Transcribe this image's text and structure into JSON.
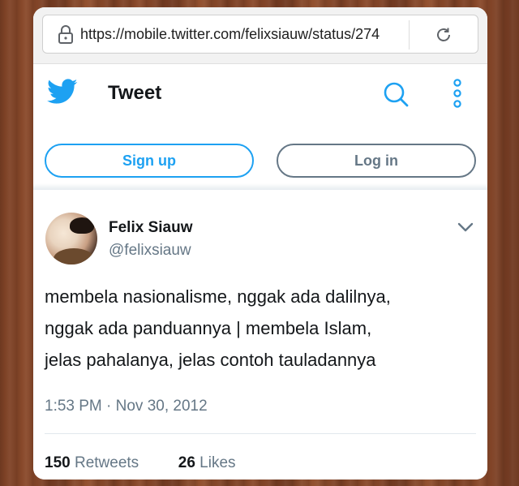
{
  "browser": {
    "url": "https://mobile.twitter.com/felixsiauw/status/274",
    "icons": {
      "lock": "lock-icon",
      "reload": "reload-icon"
    }
  },
  "header": {
    "title": "Tweet",
    "icons": {
      "logo": "twitter-bird-icon",
      "search": "search-icon",
      "more": "more-vertical-icon"
    },
    "signup_label": "Sign up",
    "login_label": "Log in"
  },
  "tweet": {
    "author_name": "Felix Siauw",
    "author_handle": "@felixsiauw",
    "text": "membela nasionalisme, nggak ada dalilnya,\nnggak ada panduannya | membela Islam,\njelas pahalanya, jelas contoh tauladannya",
    "timestamp": "1:53 PM · Nov 30, 2012",
    "retweets_count": "150",
    "retweets_label": "Retweets",
    "likes_count": "26",
    "likes_label": "Likes"
  },
  "colors": {
    "twitter_blue": "#1da1f2",
    "secondary_text": "#657786",
    "primary_text": "#14171a"
  }
}
